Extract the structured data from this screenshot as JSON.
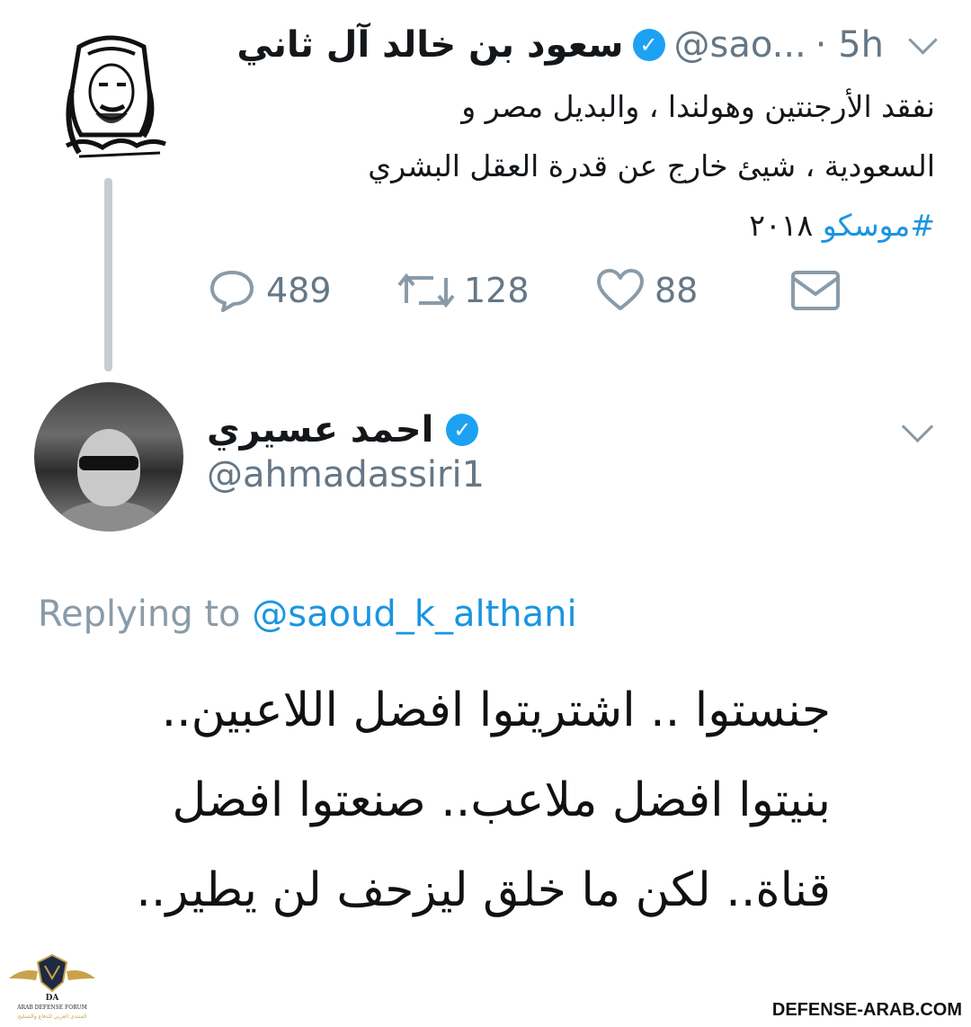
{
  "tweet": {
    "author_name": "سعود بن خالد آل ثاني",
    "handle": "@sao...",
    "time": "· 5h",
    "lines": [
      "نفقد الأرجنتين وهولندا ، والبديل مصر و",
      "السعودية ، شيئ خارج عن قدرة العقل البشري"
    ],
    "hashtag": "#موسكو",
    "hashtag_suffix": "٢٠١٨",
    "replies": "489",
    "retweets": "128",
    "likes": "88"
  },
  "reply": {
    "author_name": "احمد عسيري",
    "handle": "@ahmadassiri1",
    "replying_prefix": "Replying to",
    "replying_to": "@saoud_k_althani",
    "lines": [
      "جنستوا .. اشتريتوا افضل اللاعبين..",
      "بنيتوا افضل ملاعب.. صنعتوا افضل",
      "قناة.. لكن ما خلق ليزحف لن يطير.."
    ]
  },
  "watermark": {
    "logo_badge": "DA",
    "logo_text": "ARAB DEFENSE FORUM",
    "logo_sub": "المنتدى العربي للدفاع والتسليح",
    "site": "DEFENSE-ARAB.COM"
  },
  "colors": {
    "verified": "#1da1f2",
    "link": "#1b95e0",
    "muted": "#657786"
  }
}
